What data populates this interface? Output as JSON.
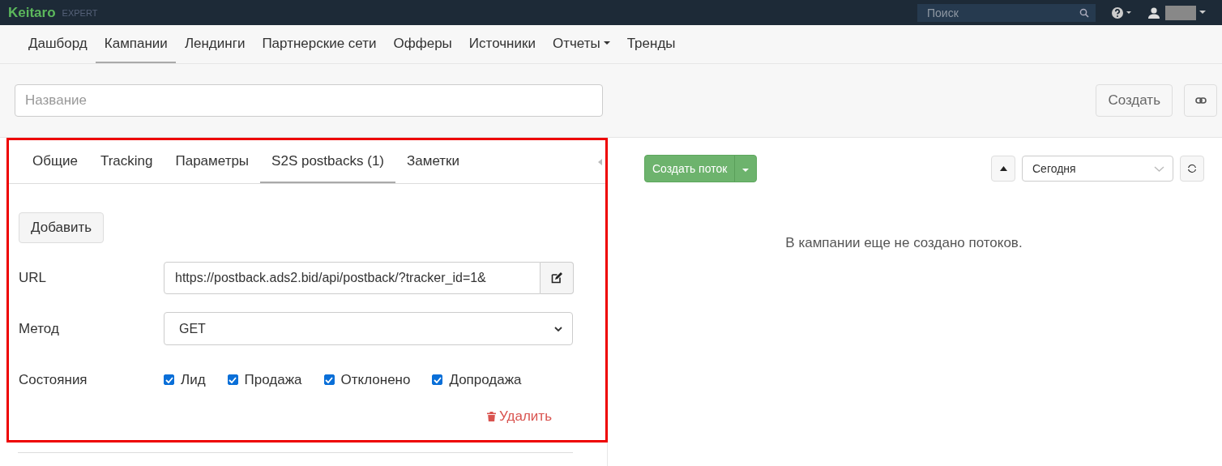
{
  "topbar": {
    "logo": "Keitaro",
    "edition": "EXPERT",
    "search": {
      "placeholder": "Поиск"
    }
  },
  "nav": [
    {
      "label": "Дашборд",
      "selected": false,
      "dropdown": false
    },
    {
      "label": "Кампании",
      "selected": true,
      "dropdown": false
    },
    {
      "label": "Лендинги",
      "selected": false,
      "dropdown": false
    },
    {
      "label": "Партнерские сети",
      "selected": false,
      "dropdown": false
    },
    {
      "label": "Офферы",
      "selected": false,
      "dropdown": false
    },
    {
      "label": "Источники",
      "selected": false,
      "dropdown": false
    },
    {
      "label": "Отчеты",
      "selected": false,
      "dropdown": true
    },
    {
      "label": "Тренды",
      "selected": false,
      "dropdown": false
    }
  ],
  "name_field": {
    "placeholder": "Название"
  },
  "create_button": "Создать",
  "tabs": [
    {
      "label": "Общие",
      "selected": false
    },
    {
      "label": "Tracking",
      "selected": false
    },
    {
      "label": "Параметры",
      "selected": false
    },
    {
      "label": "S2S postbacks (1)",
      "selected": true
    },
    {
      "label": "Заметки",
      "selected": false
    }
  ],
  "add_button": "Добавить",
  "url": {
    "label": "URL",
    "value": "https://postback.ads2.bid/api/postback/?tracker_id=1&"
  },
  "method": {
    "label": "Метод",
    "value": "GET"
  },
  "states": {
    "label": "Состояния",
    "options": [
      {
        "label": "Лид",
        "checked": true
      },
      {
        "label": "Продажа",
        "checked": true
      },
      {
        "label": "Отклонено",
        "checked": true
      },
      {
        "label": "Допродажа",
        "checked": true
      }
    ]
  },
  "delete_link": "Удалить",
  "create_stream_button": "Создать поток",
  "period": "Сегодня",
  "empty_message": "В кампании еще не создано потоков."
}
